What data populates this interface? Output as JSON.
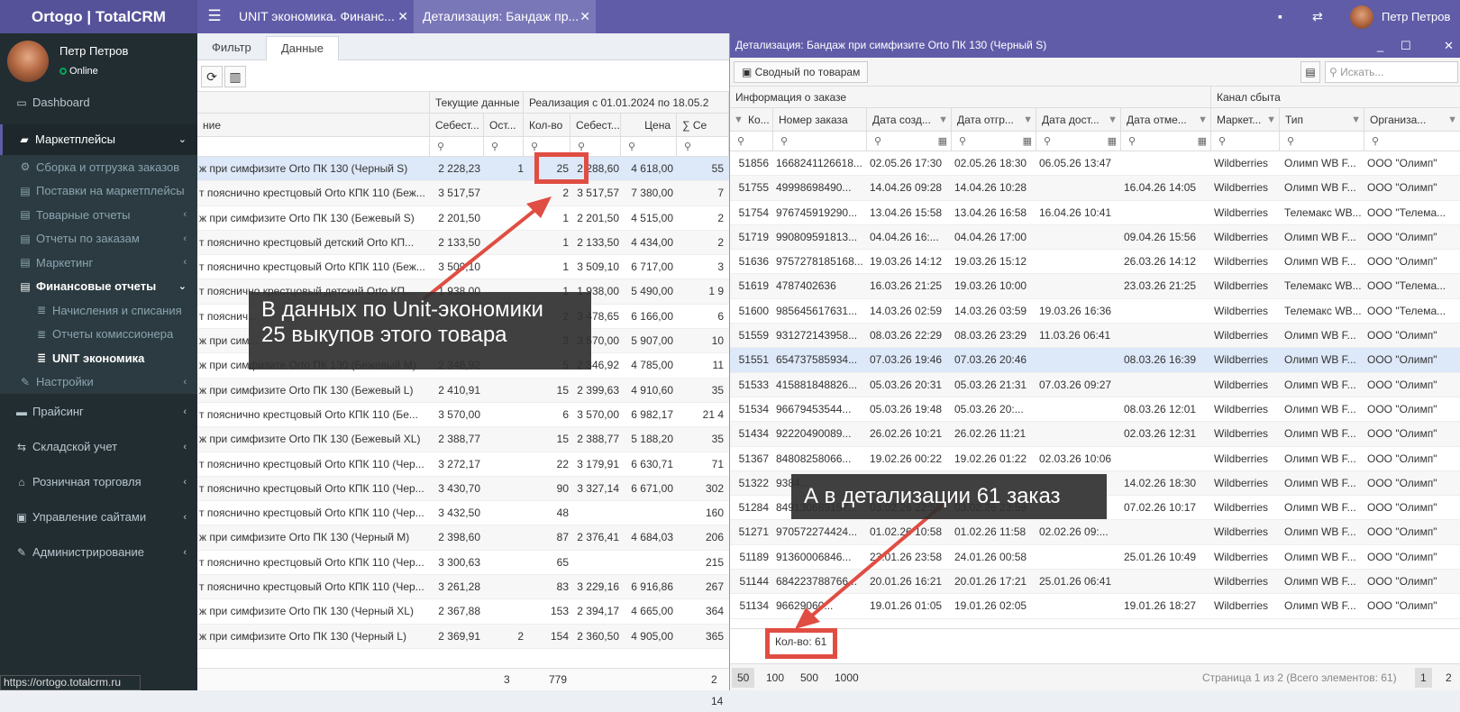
{
  "app": {
    "logo": "Ortogo | TotalCRM"
  },
  "tabs": [
    {
      "label": "UNIT экономика. Финанс..."
    },
    {
      "label": "Детализация: Бандаж пр..."
    }
  ],
  "topbar": {
    "user_name": "Петр Петров"
  },
  "user": {
    "name": "Петр Петров",
    "status": "Online"
  },
  "sidebar": {
    "dashboard": "Dashboard",
    "marketplaces": "Маркетплейсы",
    "assembly": "Сборка и отгрузка заказов",
    "supplies": "Поставки на маркетплейсы",
    "goods_reports": "Товарные отчеты",
    "order_reports": "Отчеты по заказам",
    "marketing": "Маркетинг",
    "fin_reports": "Финансовые отчеты",
    "charges": "Начисления и списания",
    "commission": "Отчеты комиссионера",
    "unit": "UNIT экономика",
    "settings": "Настройки",
    "pricing": "Прайсинг",
    "warehouse": "Складской учет",
    "retail": "Розничная торговля",
    "sites": "Управление сайтами",
    "admin": "Администрирование"
  },
  "status_url": "https://ortogo.totalcrm.ru",
  "main": {
    "subtabs": [
      "Фильтр",
      "Данные"
    ],
    "header_groups": [
      "Текущие данные",
      "Реализация с 01.01.2024 по 18.05.2"
    ],
    "columns": [
      "ние",
      "Себест...",
      "Ост...",
      "Кол-во",
      "Себест...",
      "Цена",
      "∑ Се"
    ],
    "rows": [
      [
        "ж при симфизите Orto ПК 130 (Черный S)",
        "2 228,23",
        "1",
        "25",
        "2 288,60",
        "4 618,00",
        "55"
      ],
      [
        "т пояснично крестцовый Orto КПК 110 (Беж...",
        "3 517,57",
        "",
        "2",
        "3 517,57",
        "7 380,00",
        "7"
      ],
      [
        "ж при симфизите Orto ПК 130 (Бежевый S)",
        "2 201,50",
        "",
        "1",
        "2 201,50",
        "4 515,00",
        "2"
      ],
      [
        "т пояснично крестцовый детский Orto КП...",
        "2 133,50",
        "",
        "1",
        "2 133,50",
        "4 434,00",
        "2"
      ],
      [
        "т пояснично крестцовый Orto КПК 110 (Беж...",
        "3 509,10",
        "",
        "1",
        "3 509,10",
        "6 717,00",
        "3"
      ],
      [
        "т пояснично крестцовый детский Orto КП...",
        "1 938,00",
        "",
        "1",
        "1 938,00",
        "5 490,00",
        "1 9"
      ],
      [
        "т пояснич...",
        "",
        "",
        "2",
        "3 478,65",
        "6 166,00",
        "6"
      ],
      [
        "ж при сим...",
        "",
        "",
        "3",
        "3 570,00",
        "5 907,00",
        "10"
      ],
      [
        "ж при симфизите Orto ПК 130 (Бежевый M)",
        "2 346,92",
        "",
        "5",
        "2 346,92",
        "4 785,00",
        "11"
      ],
      [
        "ж при симфизите Orto ПК 130 (Бежевый L)",
        "2 410,91",
        "",
        "15",
        "2 399,63",
        "4 910,60",
        "35"
      ],
      [
        "т пояснично крестцовый Orto КПК 110 (Бе...",
        "3 570,00",
        "",
        "6",
        "3 570,00",
        "6 982,17",
        "21 4"
      ],
      [
        "ж при симфизите Orto ПК 130 (Бежевый XL)",
        "2 388,77",
        "",
        "15",
        "2 388,77",
        "5 188,20",
        "35"
      ],
      [
        "т пояснично крестцовый Orto КПК 110 (Чер...",
        "3 272,17",
        "",
        "22",
        "3 179,91",
        "6 630,71",
        "71"
      ],
      [
        "т пояснично крестцовый Orto КПК 110 (Чер...",
        "3 430,70",
        "",
        "90",
        "3 327,14",
        "6 671,00",
        "302"
      ],
      [
        "т пояснично крестцовый Orto КПК 110 (Чер...",
        "3 432,50",
        "",
        "48",
        "",
        "",
        "160"
      ],
      [
        "ж при симфизите Orto ПК 130 (Черный M)",
        "2 398,60",
        "",
        "87",
        "2 376,41",
        "4 684,03",
        "206"
      ],
      [
        "т пояснично крестцовый Orto КПК 110 (Чер...",
        "3 300,63",
        "",
        "65",
        "",
        "",
        "215"
      ],
      [
        "т пояснично крестцовый Orto КПК 110 (Чер...",
        "3 261,28",
        "",
        "83",
        "3 229,16",
        "6 916,86",
        "267"
      ],
      [
        "ж при симфизите Orto ПК 130 (Черный XL)",
        "2 367,88",
        "",
        "153",
        "2 394,17",
        "4 665,00",
        "364"
      ],
      [
        "ж при симфизите Orto ПК 130 (Черный L)",
        "2 369,91",
        "2",
        "154",
        "2 360,50",
        "4 905,00",
        "365"
      ]
    ],
    "totals": {
      "ost": "3",
      "qty": "779",
      "sum": "2 14"
    }
  },
  "detail": {
    "title": "Детализация: Бандаж при симфизите Orto ПК 130 (Черный S)",
    "summary_button": "Сводный по товарам",
    "search_placeholder": "Искать...",
    "group_order": "Информация о заказе",
    "group_channel": "Канал сбыта",
    "columns": [
      "Ко...",
      "Номер заказа",
      "Дата созд...",
      "Дата отгр...",
      "Дата дост...",
      "Дата отме...",
      "Маркет...",
      "Тип",
      "Организа..."
    ],
    "rows": [
      [
        "51856",
        "1668241126618...",
        "02.05.26 17:30",
        "02.05.26 18:30",
        "06.05.26 13:47",
        "",
        "Wildberries",
        "Олимп WB F...",
        "ООО \"Олимп\""
      ],
      [
        "51755",
        "49998698490...",
        "14.04.26 09:28",
        "14.04.26 10:28",
        "",
        "16.04.26 14:05",
        "Wildberries",
        "Олимп WB F...",
        "ООО \"Олимп\""
      ],
      [
        "51754",
        "976745919290...",
        "13.04.26 15:58",
        "13.04.26 16:58",
        "16.04.26 10:41",
        "",
        "Wildberries",
        "Телемакс WB...",
        "ООО \"Телема..."
      ],
      [
        "51719",
        "990809591813...",
        "04.04.26 16:...",
        "04.04.26 17:00",
        "",
        "09.04.26 15:56",
        "Wildberries",
        "Олимп WB F...",
        "ООО \"Олимп\""
      ],
      [
        "51636",
        "9757278185168...",
        "19.03.26 14:12",
        "19.03.26 15:12",
        "",
        "26.03.26 14:12",
        "Wildberries",
        "Олимп WB F...",
        "ООО \"Олимп\""
      ],
      [
        "51619",
        "4787402636",
        "16.03.26 21:25",
        "19.03.26 10:00",
        "",
        "23.03.26 21:25",
        "Wildberries",
        "Телемакс WB...",
        "ООО \"Телема..."
      ],
      [
        "51600",
        "985645617631...",
        "14.03.26 02:59",
        "14.03.26 03:59",
        "19.03.26 16:36",
        "",
        "Wildberries",
        "Телемакс WB...",
        "ООО \"Телема..."
      ],
      [
        "51559",
        "931272143958...",
        "08.03.26 22:29",
        "08.03.26 23:29",
        "11.03.26 06:41",
        "",
        "Wildberries",
        "Олимп WB F...",
        "ООО \"Олимп\""
      ],
      [
        "51551",
        "654737585934...",
        "07.03.26 19:46",
        "07.03.26 20:46",
        "",
        "08.03.26 16:39",
        "Wildberries",
        "Олимп WB F...",
        "ООО \"Олимп\""
      ],
      [
        "51533",
        "415881848826...",
        "05.03.26 20:31",
        "05.03.26 21:31",
        "07.03.26 09:27",
        "",
        "Wildberries",
        "Олимп WB F...",
        "ООО \"Олимп\""
      ],
      [
        "51534",
        "96679453544...",
        "05.03.26 19:48",
        "05.03.26 20:...",
        "",
        "08.03.26 12:01",
        "Wildberries",
        "Олимп WB F...",
        "ООО \"Олимп\""
      ],
      [
        "51434",
        "92220490089...",
        "26.02.26 10:21",
        "26.02.26 11:21",
        "",
        "02.03.26 12:31",
        "Wildberries",
        "Олимп WB F...",
        "ООО \"Олимп\""
      ],
      [
        "51367",
        "84808258066...",
        "19.02.26 00:22",
        "19.02.26 01:22",
        "02.03.26 10:06",
        "",
        "Wildberries",
        "Олимп WB F...",
        "ООО \"Олимп\""
      ],
      [
        "51322",
        "9384...",
        "",
        "",
        "",
        "14.02.26 18:30",
        "Wildberries",
        "Олимп WB F...",
        "ООО \"Олимп\""
      ],
      [
        "51284",
        "849130689157...",
        "03.02.26 22:59",
        "03.02.26 23:59",
        "",
        "07.02.26 10:17",
        "Wildberries",
        "Олимп WB F...",
        "ООО \"Олимп\""
      ],
      [
        "51271",
        "970572274424...",
        "01.02.26 10:58",
        "01.02.26 11:58",
        "02.02.26 09:...",
        "",
        "Wildberries",
        "Олимп WB F...",
        "ООО \"Олимп\""
      ],
      [
        "51189",
        "91360006846...",
        "23.01.26 23:58",
        "24.01.26 00:58",
        "",
        "25.01.26 10:49",
        "Wildberries",
        "Олимп WB F...",
        "ООО \"Олимп\""
      ],
      [
        "51144",
        "684223788766...",
        "20.01.26 16:21",
        "20.01.26 17:21",
        "25.01.26 06:41",
        "",
        "Wildberries",
        "Олимп WB F...",
        "ООО \"Олимп\""
      ],
      [
        "51134",
        "96629060...",
        "19.01.26 01:05",
        "19.01.26 02:05",
        "",
        "19.01.26 18:27",
        "Wildberries",
        "Олимп WB F...",
        "ООО \"Олимп\""
      ]
    ],
    "count": "Кол-во: 61",
    "page_sizes": [
      "50",
      "100",
      "500",
      "1000"
    ],
    "page_info": "Страница 1 из 2 (Всего элементов: 61)",
    "pages": [
      "1",
      "2"
    ]
  },
  "annotations": {
    "left_line1": "В данных по Unit-экономики",
    "left_line2": "25 выкупов этого товара",
    "right": "А в детализации 61 заказ"
  },
  "colors": {
    "topbar": "#605ca8",
    "sidebar": "#222d32",
    "highlight": "#e04d43"
  }
}
